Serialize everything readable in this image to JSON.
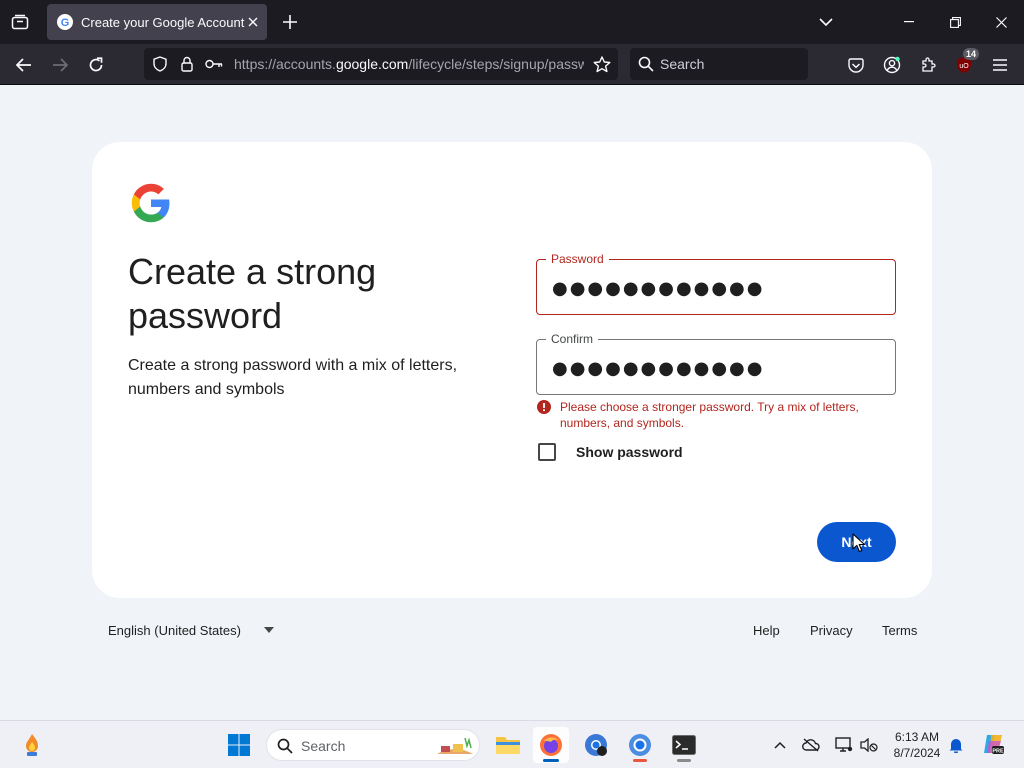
{
  "browser": {
    "tab": {
      "title": "Create your Google Account"
    },
    "url": {
      "prefix": "https://accounts.",
      "host": "google.com",
      "path": "/lifecycle/steps/signup/passw"
    },
    "search_placeholder": "Search",
    "extension_badge": "14"
  },
  "page": {
    "heading": "Create a strong password",
    "subtext": "Create a strong password with a mix of letters, numbers and symbols",
    "password": {
      "label": "Password",
      "value": "●●●●●●●●●●●●"
    },
    "confirm": {
      "label": "Confirm",
      "value": "●●●●●●●●●●●●"
    },
    "error": "Please choose a stronger password. Try a mix of letters, numbers, and symbols.",
    "show_password_label": "Show password",
    "next_label": "Next"
  },
  "footer": {
    "language": "English (United States)",
    "links": {
      "help": "Help",
      "privacy": "Privacy",
      "terms": "Terms"
    }
  },
  "taskbar": {
    "search_placeholder": "Search",
    "time": "6:13 AM",
    "date": "8/7/2024"
  },
  "colors": {
    "accent": "#0b57d0",
    "error": "#b3261e",
    "page_bg": "#f0f4f9"
  }
}
